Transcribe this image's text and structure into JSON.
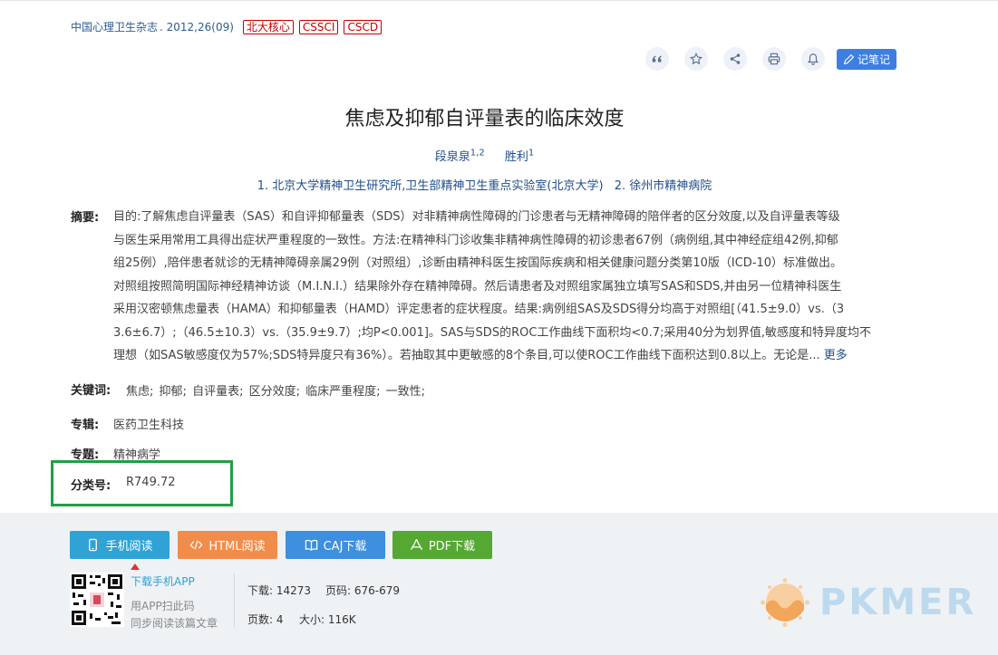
{
  "source": {
    "journal": "中国心理卫生杂志",
    "issue": ". 2012,26(09)",
    "badges": [
      "北大核心",
      "CSSCI",
      "CSCD"
    ]
  },
  "toolbar": {
    "icons": [
      "quote-icon",
      "star-icon",
      "share-icon",
      "print-icon",
      "bell-icon"
    ],
    "note_label": "记笔记"
  },
  "title": "焦虑及抑郁自评量表的临床效度",
  "authors": [
    {
      "name": "段泉泉",
      "sup": "1,2"
    },
    {
      "name": "胜利",
      "sup": "1"
    }
  ],
  "affiliations": [
    "1. 北京大学精神卫生研究所,卫生部精神卫生重点实验室(北京大学)",
    "2. 徐州市精神病院"
  ],
  "abstract": {
    "label": "摘要:",
    "lines": [
      "目的:了解焦虑自评量表（SAS）和自评抑郁量表（SDS）对非精神病性障碍的门诊患者与无精神障碍的陪伴者的区分效度,以及自评量表等级",
      "与医生采用常用工具得出症状严重程度的一致性。方法:在精神科门诊收集非精神病性障碍的初诊患者67例（病例组,其中神经症组42例,抑郁",
      "组25例）,陪伴患者就诊的无精神障碍亲属29例（对照组）,诊断由精神科医生按国际疾病和相关健康问题分类第10版（ICD-10）标准做出。",
      "对照组按照简明国际神经精神访谈（M.I.N.I.）结果除外存在精神障碍。然后请患者及对照组家属独立填写SAS和SDS,并由另一位精神科医生",
      "采用汉密顿焦虑量表（HAMA）和抑郁量表（HAMD）评定患者的症状程度。结果:病例组SAS及SDS得分均高于对照组[（41.5±9.0）vs.（3",
      "3.6±6.7）;（46.5±10.3）vs.（35.9±9.7）;均P<0.001]。SAS与SDS的ROC工作曲线下面积均<0.7;采用40分为划界值,敏感度和特异度均不",
      "理想（如SAS敏感度仅为57%;SDS特异度只有36%）。若抽取其中更敏感的8个条目,可以使ROC工作曲线下面积达到0.8以上。无论是..."
    ],
    "more": "更多"
  },
  "keywords": {
    "label": "关键词:",
    "items": [
      "焦虑;",
      "抑郁;",
      "自评量表;",
      "区分效度;",
      "临床严重程度;",
      "一致性;"
    ]
  },
  "album": {
    "label": "专辑:",
    "value": "医药卫生科技"
  },
  "topic": {
    "label": "专题:",
    "value": "精神病学"
  },
  "classification": {
    "label": "分类号:",
    "value": "R749.72"
  },
  "actions": {
    "mobile": "手机阅读",
    "html": "HTML阅读",
    "caj": "CAJ下载",
    "pdf": "PDF下载"
  },
  "app": {
    "link": "下载手机APP",
    "tip1": "用APP扫此码",
    "tip2": "同步阅读该篇文章"
  },
  "stats": {
    "downloads_label": "下载:",
    "downloads": "14273",
    "pages_label": "页码:",
    "pages": "676-679",
    "page_count_label": "页数:",
    "page_count": "4",
    "size_label": "大小:",
    "size": "116K"
  },
  "watermark": "PKMER",
  "colors": {
    "link": "#1f4d8c",
    "badge": "#c40000",
    "highlight": "#1fa042",
    "mobile": "#2fa2d6",
    "html": "#f28c4a",
    "caj": "#3d8fe0",
    "pdf": "#55a832"
  }
}
